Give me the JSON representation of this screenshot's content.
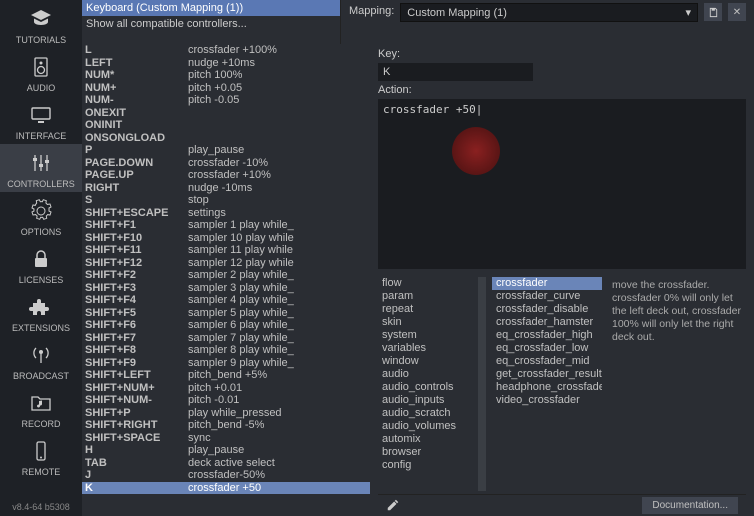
{
  "sidebar": {
    "items": [
      {
        "label": "TUTORIALS"
      },
      {
        "label": "AUDIO"
      },
      {
        "label": "INTERFACE"
      },
      {
        "label": "CONTROLLERS"
      },
      {
        "label": "OPTIONS"
      },
      {
        "label": "LICENSES"
      },
      {
        "label": "EXTENSIONS"
      },
      {
        "label": "BROADCAST"
      },
      {
        "label": "RECORD"
      },
      {
        "label": "REMOTE"
      }
    ],
    "version": "v8.4-64 b5308"
  },
  "devices": {
    "selected": "Keyboard (Custom Mapping (1))",
    "other": "Show all compatible controllers..."
  },
  "mapping": {
    "label": "Mapping:",
    "value": "Custom Mapping (1)"
  },
  "keylabel": "Key:",
  "keyvalue": "K",
  "actionlabel": "Action:",
  "actionvalue": "crossfader +50|",
  "bindings": [
    {
      "k": "L",
      "a": "crossfader +100%"
    },
    {
      "k": "LEFT",
      "a": "nudge +10ms"
    },
    {
      "k": "NUM*",
      "a": "pitch 100%"
    },
    {
      "k": "NUM+",
      "a": "pitch +0.05"
    },
    {
      "k": "NUM-",
      "a": "pitch -0.05"
    },
    {
      "k": "ONEXIT",
      "a": ""
    },
    {
      "k": "ONINIT",
      "a": ""
    },
    {
      "k": "ONSONGLOAD",
      "a": ""
    },
    {
      "k": "P",
      "a": "play_pause"
    },
    {
      "k": "PAGE.DOWN",
      "a": "crossfader -10%"
    },
    {
      "k": "PAGE.UP",
      "a": "crossfader +10%"
    },
    {
      "k": "RIGHT",
      "a": "nudge -10ms"
    },
    {
      "k": "S",
      "a": "stop"
    },
    {
      "k": "SHIFT+ESCAPE",
      "a": "settings"
    },
    {
      "k": "SHIFT+F1",
      "a": "sampler 1 play while_"
    },
    {
      "k": "SHIFT+F10",
      "a": "sampler 10 play while"
    },
    {
      "k": "SHIFT+F11",
      "a": "sampler 11 play while"
    },
    {
      "k": "SHIFT+F12",
      "a": "sampler 12 play while"
    },
    {
      "k": "SHIFT+F2",
      "a": "sampler 2 play while_"
    },
    {
      "k": "SHIFT+F3",
      "a": "sampler 3 play while_"
    },
    {
      "k": "SHIFT+F4",
      "a": "sampler 4 play while_"
    },
    {
      "k": "SHIFT+F5",
      "a": "sampler 5 play while_"
    },
    {
      "k": "SHIFT+F6",
      "a": "sampler 6 play while_"
    },
    {
      "k": "SHIFT+F7",
      "a": "sampler 7 play while_"
    },
    {
      "k": "SHIFT+F8",
      "a": "sampler 8 play while_"
    },
    {
      "k": "SHIFT+F9",
      "a": "sampler 9 play while_"
    },
    {
      "k": "SHIFT+LEFT",
      "a": "pitch_bend +5%"
    },
    {
      "k": "SHIFT+NUM+",
      "a": "pitch +0.01"
    },
    {
      "k": "SHIFT+NUM-",
      "a": "pitch -0.01"
    },
    {
      "k": "SHIFT+P",
      "a": "play while_pressed"
    },
    {
      "k": "SHIFT+RIGHT",
      "a": "pitch_bend -5%"
    },
    {
      "k": "SHIFT+SPACE",
      "a": "sync"
    },
    {
      "k": "H",
      "a": "play_pause"
    },
    {
      "k": "TAB",
      "a": "deck active select"
    },
    {
      "k": "J",
      "a": "crossfader-50%"
    },
    {
      "k": "K",
      "a": "crossfader +50"
    }
  ],
  "cats": [
    "flow",
    "param",
    "repeat",
    "skin",
    "system",
    "variables",
    "window",
    "audio",
    "audio_controls",
    "audio_inputs",
    "audio_scratch",
    "audio_volumes",
    "automix",
    "browser",
    "config"
  ],
  "verbs": [
    "crossfader",
    "crossfader_curve",
    "crossfader_disable",
    "crossfader_hamster",
    "eq_crossfader_high",
    "eq_crossfader_low",
    "eq_crossfader_mid",
    "get_crossfader_result",
    "headphone_crossfade",
    "video_crossfader"
  ],
  "help": "move the crossfader. crossfader 0% will only let the left deck out, crossfader 100% will only let the right deck out.",
  "docbtn": "Documentation..."
}
